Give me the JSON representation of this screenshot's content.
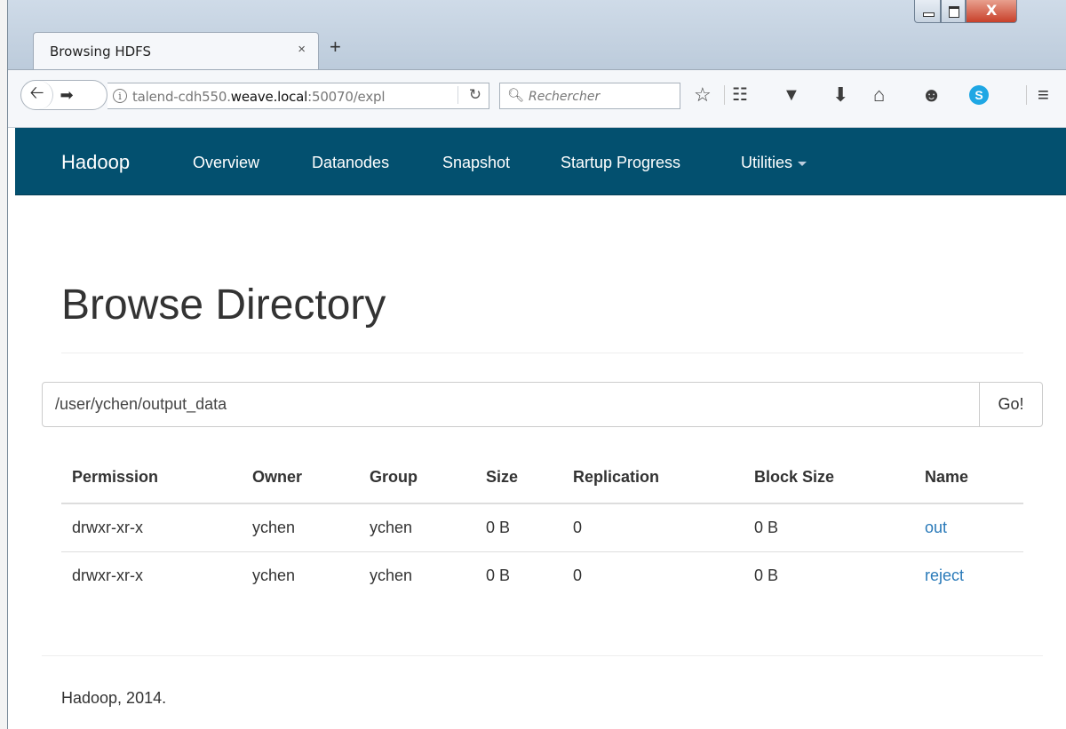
{
  "browser": {
    "tab_title": "Browsing HDFS",
    "tab_close": "×",
    "new_tab": "+",
    "url_host_prefix": "talend-cdh550.",
    "url_host_domain": "weave.local",
    "url_rest": ":50070/expl",
    "search_placeholder": "Rechercher",
    "icons": [
      "back-icon",
      "forward-icon",
      "info-icon",
      "reload-icon",
      "search-icon",
      "bookmark-star-icon",
      "reading-list-icon",
      "pocket-icon",
      "download-icon",
      "home-icon",
      "chat-icon",
      "skype-icon",
      "menu-icon"
    ]
  },
  "navbar": {
    "brand": "Hadoop",
    "links": [
      "Overview",
      "Datanodes",
      "Snapshot",
      "Startup Progress",
      "Utilities"
    ]
  },
  "main": {
    "title": "Browse Directory",
    "path_value": "/user/ychen/output_data",
    "go_label": "Go!",
    "columns": [
      "Permission",
      "Owner",
      "Group",
      "Size",
      "Replication",
      "Block Size",
      "Name"
    ],
    "rows": [
      [
        "drwxr-xr-x",
        "ychen",
        "ychen",
        "0 B",
        "0",
        "0 B",
        "out"
      ],
      [
        "drwxr-xr-x",
        "ychen",
        "ychen",
        "0 B",
        "0",
        "0 B",
        "reject"
      ]
    ],
    "link_color": "#2a7ab9"
  },
  "footer": {
    "text": "Hadoop, 2014."
  },
  "colors": {
    "navbar_bg": "#03506f"
  }
}
